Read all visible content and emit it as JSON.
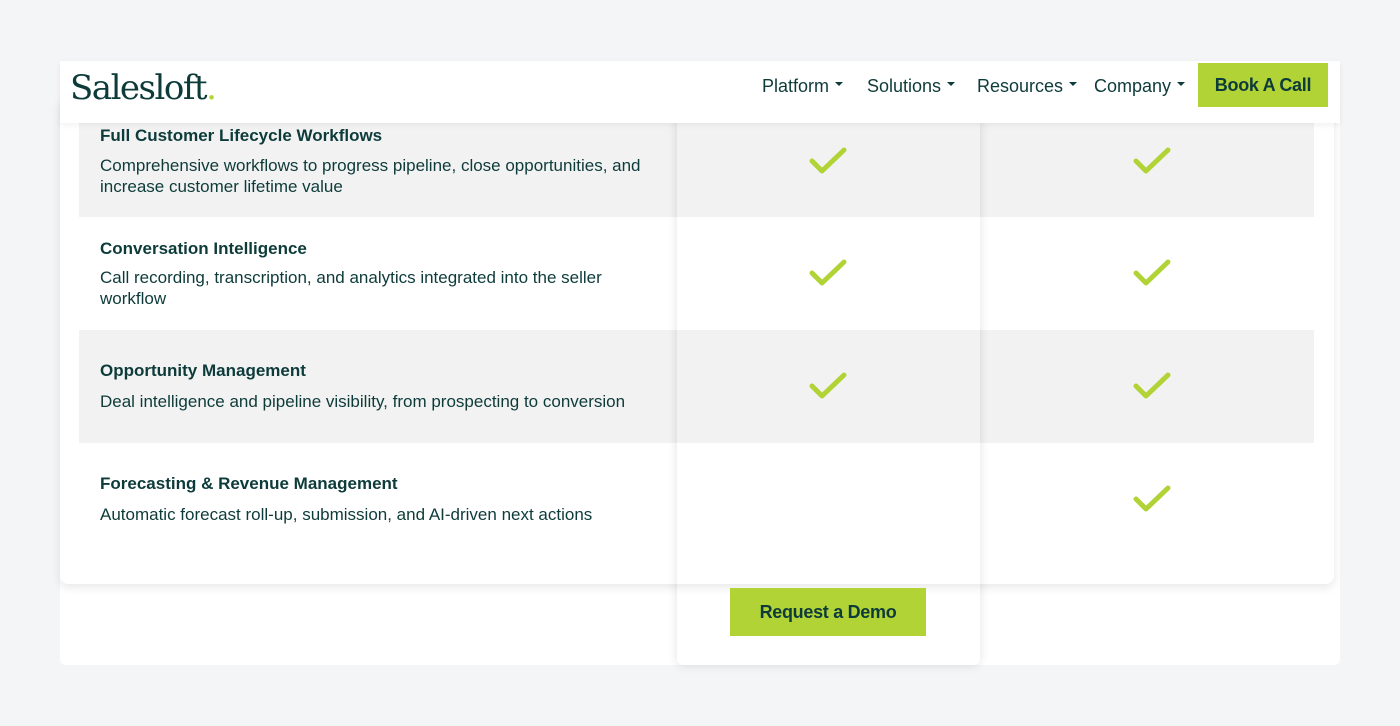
{
  "brand": {
    "logo_text": "Salesloft",
    "logo_dot": ".",
    "accent_color": "#b1d336",
    "text_color": "#0d3b3a"
  },
  "nav": {
    "items": [
      {
        "label": "Platform"
      },
      {
        "label": "Solutions"
      },
      {
        "label": "Resources"
      },
      {
        "label": "Company"
      }
    ],
    "cta_label": "Book A Call"
  },
  "features": [
    {
      "title": "Full Customer Lifecycle Workflows",
      "description": "Comprehensive workflows to progress pipeline, close opportunities, and increase customer lifetime value",
      "plan_a": true,
      "plan_b": true
    },
    {
      "title": "Conversation Intelligence",
      "description": "Call recording, transcription, and analytics integrated into the seller workflow",
      "plan_a": true,
      "plan_b": true
    },
    {
      "title": "Opportunity Management",
      "description": "Deal intelligence and pipeline visibility, from prospecting to conversion",
      "plan_a": true,
      "plan_b": true
    },
    {
      "title": "Forecasting & Revenue Management",
      "description": "Automatic forecast roll-up, submission, and AI-driven next actions",
      "plan_a": false,
      "plan_b": true
    }
  ],
  "demo_cta_label": "Request a Demo",
  "icons": {
    "included": "check-icon"
  }
}
